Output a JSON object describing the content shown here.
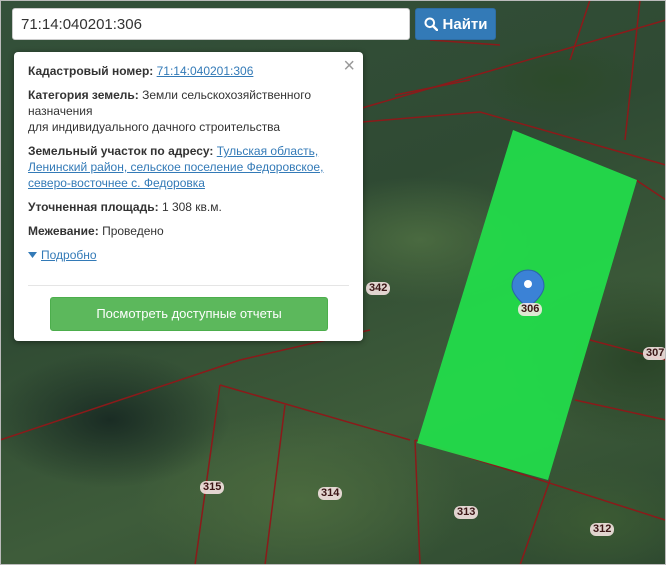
{
  "search": {
    "value": "71:14:040201:306",
    "button_label": "Найти"
  },
  "popup": {
    "cadastral_label": "Кадастровый номер:",
    "cadastral_value": "71:14:040201:306",
    "category_label": "Категория земель:",
    "category_value_line1": "Земли сельскохозяйственного",
    "category_value_line2": "назначения",
    "category_value_line3": "для индивидуального дачного строительства",
    "address_label": "Земельный участок по адресу:",
    "address_line1": "Тульская область,",
    "address_line2": "Ленинский район, сельское поселение Федоровское,",
    "address_line3": "северо-восточнее с. Федоровка",
    "area_label": "Уточненная площадь:",
    "area_value": "1 308 кв.м.",
    "survey_label": "Межевание:",
    "survey_value": "Проведено",
    "details_link": "Подробно",
    "report_button": "Посмотреть доступные отчеты",
    "close_glyph": "×"
  },
  "map": {
    "selected_parcel_color": "#22e04b",
    "boundary_color": "#8b1a1a",
    "marker_color": "#3b82d6",
    "labels": {
      "p306": "306",
      "p342": "342",
      "p307": "307",
      "p315": "315",
      "p314": "314",
      "p313": "313",
      "p312": "312"
    }
  }
}
